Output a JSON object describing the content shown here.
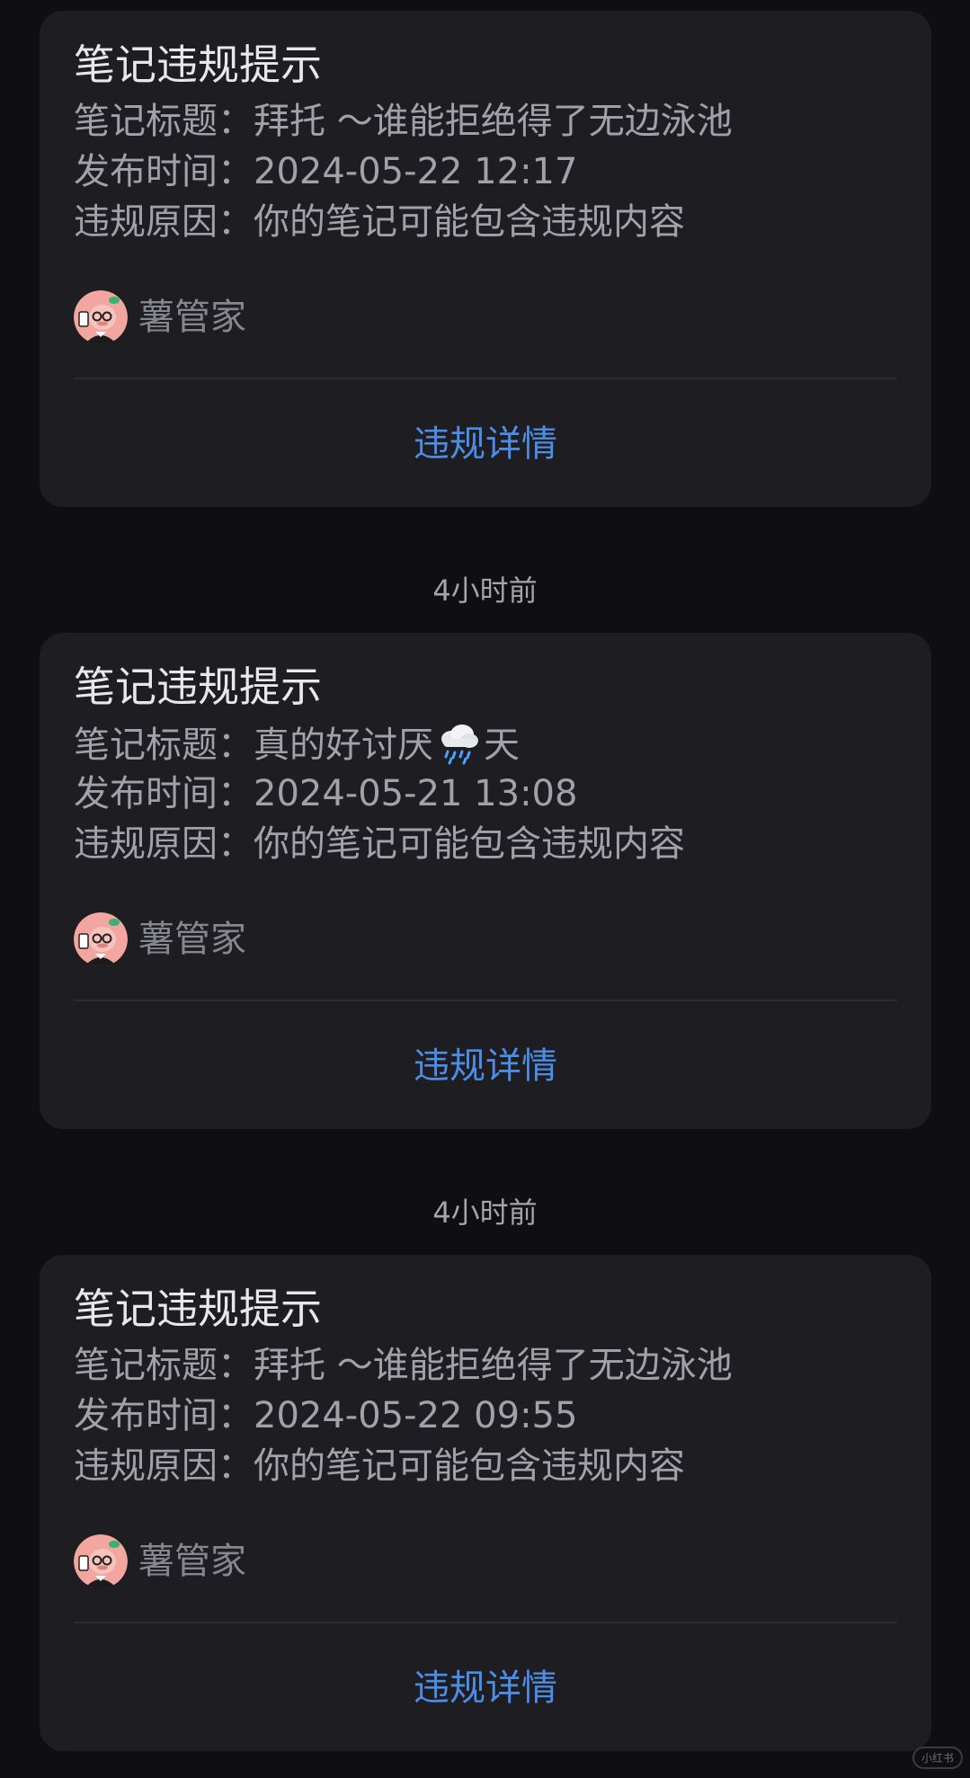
{
  "cards": [
    {
      "title": "笔记违规提示",
      "note_title_label": "笔记标题：",
      "note_title_value": "拜托 ～谁能拒绝得了无边泳池",
      "publish_time_label": "发布时间：",
      "publish_time_value": "2024-05-22 12:17",
      "reason_label": "违规原因：",
      "reason_value": "你的笔记可能包含违规内容",
      "sender": "薯管家",
      "action": "违规详情"
    },
    {
      "title": "笔记违规提示",
      "note_title_label": "笔记标题：",
      "note_title_before": "真的好讨厌",
      "note_title_icon": "cloud-with-rain-icon",
      "note_title_after": "天",
      "publish_time_label": "发布时间：",
      "publish_time_value": "2024-05-21 13:08",
      "reason_label": "违规原因：",
      "reason_value": "你的笔记可能包含违规内容",
      "sender": "薯管家",
      "action": "违规详情"
    },
    {
      "title": "笔记违规提示",
      "note_title_label": "笔记标题：",
      "note_title_value": "拜托 ～谁能拒绝得了无边泳池",
      "publish_time_label": "发布时间：",
      "publish_time_value": "2024-05-22 09:55",
      "reason_label": "违规原因：",
      "reason_value": "你的笔记可能包含违规内容",
      "sender": "薯管家",
      "action": "违规详情"
    }
  ],
  "separators": [
    "4小时前",
    "4小时前"
  ],
  "colors": {
    "background": "#0f0f12",
    "card": "#1d1d22",
    "link": "#4c8ee6",
    "avatar_face": "#f3a5a0"
  },
  "avatar_icon": "butler-avatar-icon",
  "watermark": "小红书"
}
